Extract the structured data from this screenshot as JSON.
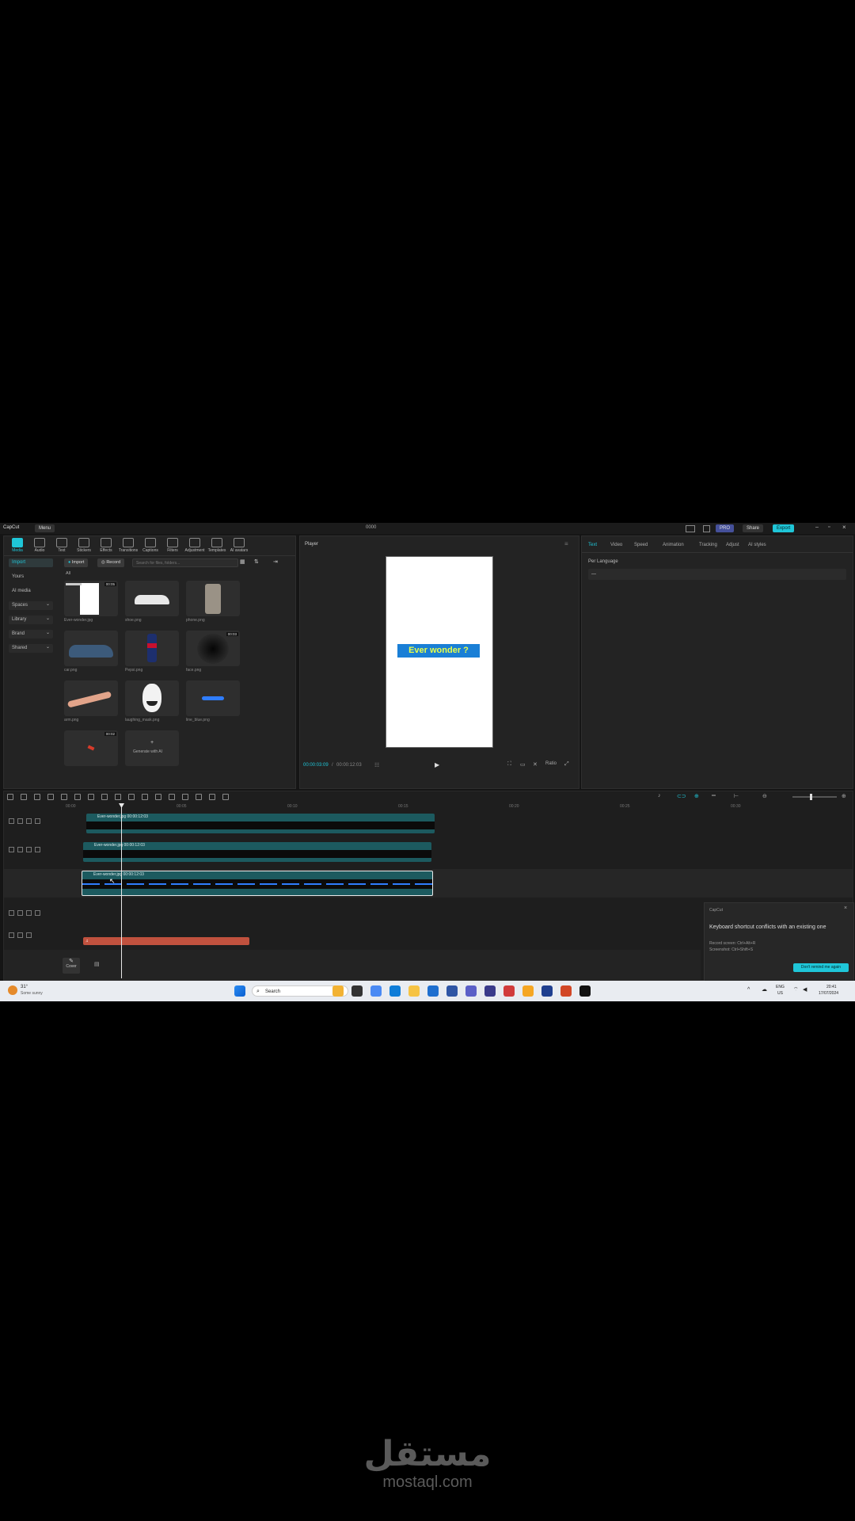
{
  "titlebar": {
    "app_name": "CapCut",
    "menu": "Menu",
    "project": "0000",
    "btn_share": "Share",
    "btn_export": "Export"
  },
  "toolbar": {
    "tools": [
      {
        "label": "Media",
        "active": true
      },
      {
        "label": "Audio"
      },
      {
        "label": "Text"
      },
      {
        "label": "Stickers"
      },
      {
        "label": "Effects"
      },
      {
        "label": "Transitions"
      },
      {
        "label": "Captions"
      },
      {
        "label": "Filters"
      },
      {
        "label": "Adjustment"
      },
      {
        "label": "Templates"
      },
      {
        "label": "AI avatars"
      }
    ]
  },
  "sidebar": {
    "items": [
      {
        "label": "Import",
        "selected": true
      },
      {
        "label": "Yours"
      },
      {
        "label": "AI media"
      },
      {
        "label": "Spaces"
      },
      {
        "label": "Library"
      },
      {
        "label": "Brand"
      },
      {
        "label": "Shared"
      }
    ]
  },
  "media": {
    "btn_import": "Import",
    "btn_record": "Record",
    "search_placeholder": "Search for files, folders...",
    "section": "All",
    "items": [
      {
        "label": "Ever-wonder.jpg",
        "badge": "00:05",
        "kind": "white"
      },
      {
        "label": "shoe.png",
        "kind": "shoe"
      },
      {
        "label": "phone.png",
        "kind": "phone"
      },
      {
        "label": "car.png",
        "kind": "car"
      },
      {
        "label": "Pepsi.png",
        "kind": "can"
      },
      {
        "label": "face.png",
        "badge": "00:03",
        "kind": "dark"
      },
      {
        "label": "arm.png",
        "kind": "arm"
      },
      {
        "label": "laughing_mask.png",
        "kind": "mask"
      },
      {
        "label": "line_blue.png",
        "kind": "line"
      },
      {
        "label": "",
        "badge": "00:02",
        "kind": "red"
      },
      {
        "label": "Generate with AI",
        "kind": "empty"
      }
    ]
  },
  "player": {
    "title": "Player",
    "caption": "Ever wonder ?",
    "timecode": "00:00:03:09",
    "duration": "00:00:12:03"
  },
  "right_panel": {
    "tabs": [
      "Text",
      "Video",
      "Speed",
      "Animation",
      "Tracking",
      "Adjust",
      "AI styles"
    ],
    "field_label": "Per Language",
    "field_value": "—"
  },
  "timeline": {
    "ruler": [
      "00:00",
      "00:05",
      "00:10",
      "00:15",
      "00:20",
      "00:25",
      "00:30"
    ],
    "tracks": [
      {
        "label": "Ever-wonder.jpg  00:00:12:03"
      },
      {
        "label": "Ever-wonder.jpg  00:00:12:03"
      },
      {
        "label": "Ever-wonder.jpg  00:00:12:03"
      }
    ],
    "cover_label": "Cover"
  },
  "notification": {
    "title": "Keyboard shortcut conflicts with an existing one",
    "line1": "Record screen: Ctrl+Alt+R",
    "line2": "Screenshot: Ctrl+Shift+S",
    "button": "Don't remind me again",
    "header": "CapCut"
  },
  "taskbar": {
    "weather_temp": "31°",
    "weather_desc": "Some sunny",
    "search": "Search",
    "lang": "ENG",
    "lang_sub": "US",
    "time": "20:41",
    "date": "17/07/2024"
  },
  "watermark": {
    "arabic": "مستقل",
    "domain": "mostaql.com"
  },
  "colors": {
    "accent": "#1fc6d8",
    "track": "#1c5a5f",
    "audio": "#c0513e"
  }
}
